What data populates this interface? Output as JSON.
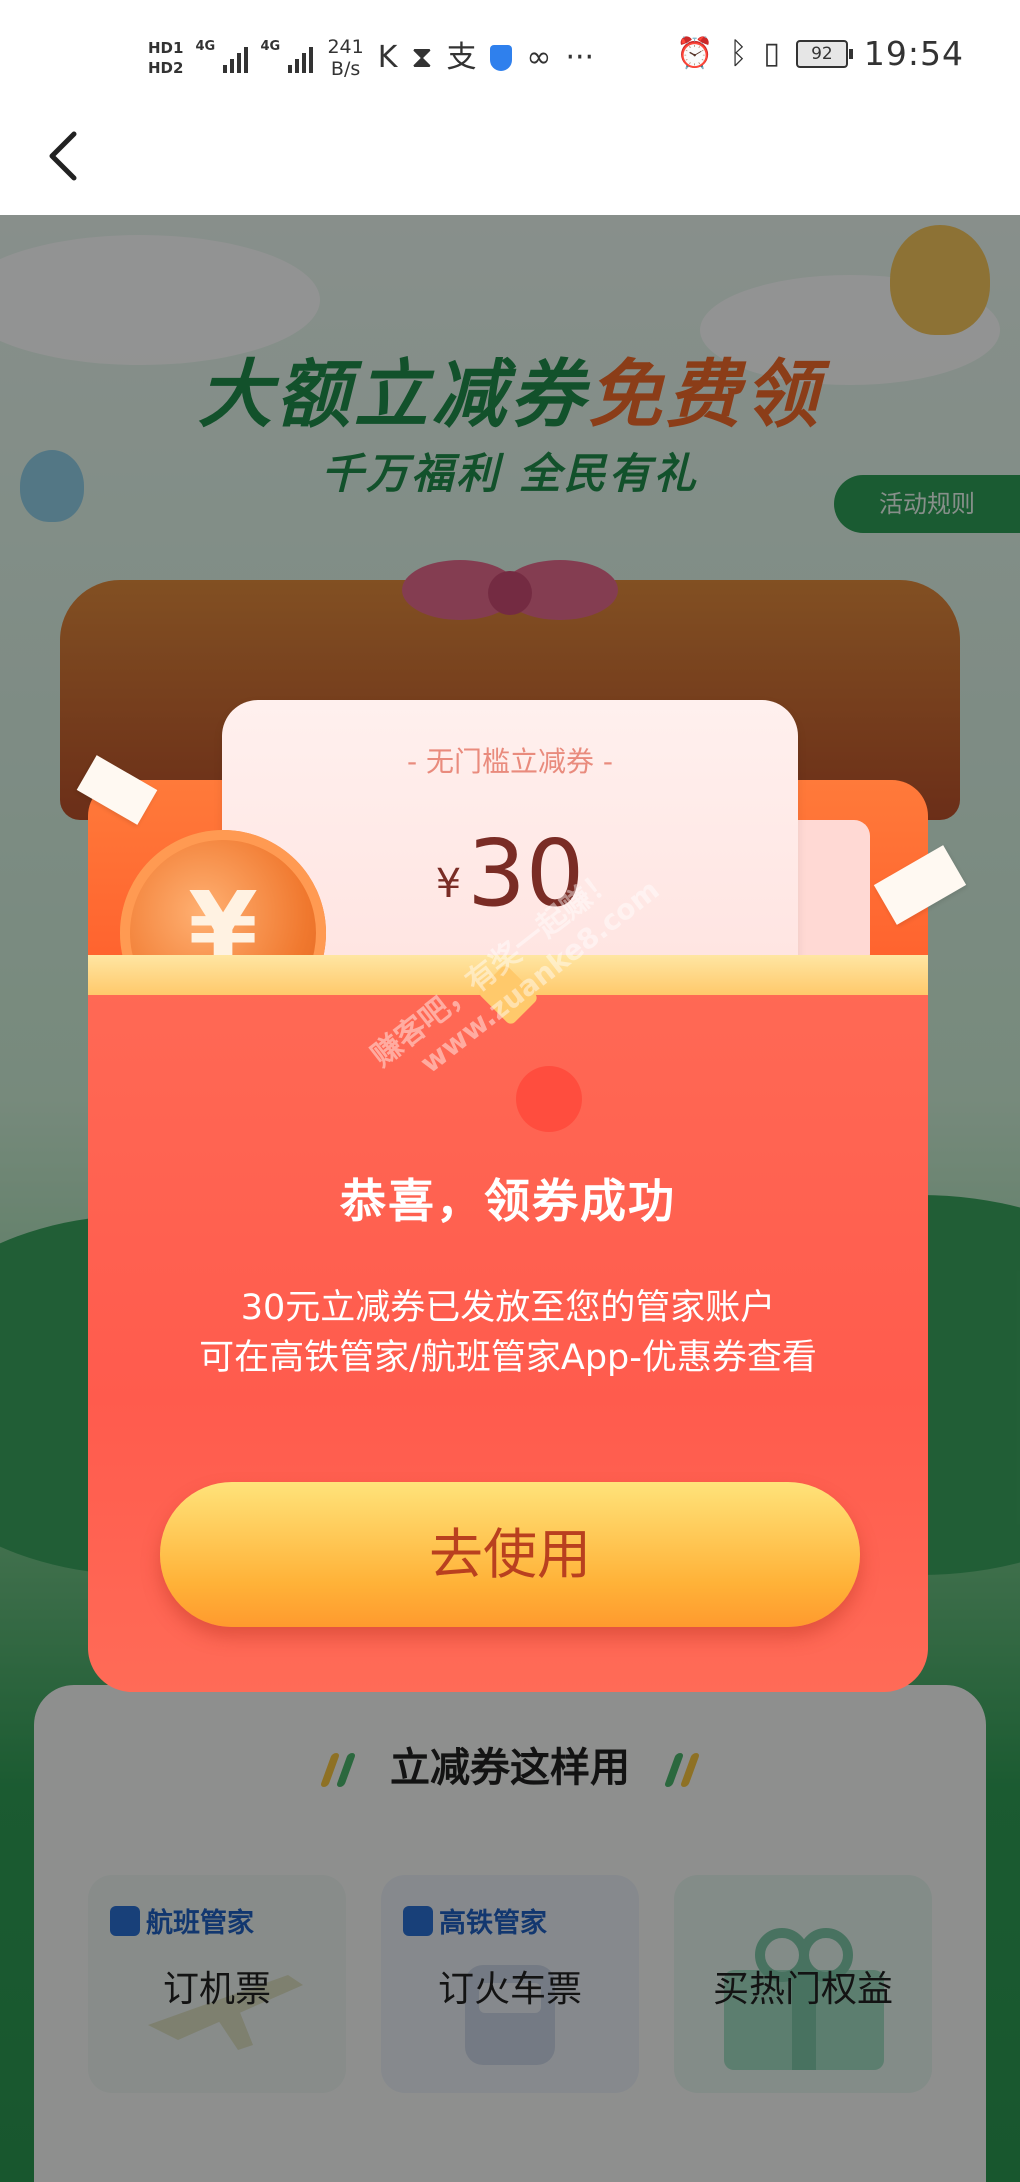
{
  "status_bar": {
    "hd1": "HD1",
    "hd2": "HD2",
    "net1": "4G",
    "net2": "4G",
    "speed_value": "241",
    "speed_unit": "B/s",
    "more": "···",
    "battery": "92",
    "time": "19:54"
  },
  "nav": {
    "back_icon": "chevron-left-icon"
  },
  "hero": {
    "title_part1": "大额立减券",
    "title_part2": "免费领",
    "subtitle": "千万福利  全民有礼",
    "rules_button": "活动规则"
  },
  "coupon": {
    "tag": "- 无门槛立减券 -",
    "currency": "¥",
    "amount": "30"
  },
  "watermark": {
    "line1": "赚客吧，有奖一起赚！",
    "line2": "www.zuanke8.com"
  },
  "result": {
    "title": "恭喜，领券成功",
    "desc_line1": "30元立减券已发放至您的管家账户",
    "desc_line2": "可在高铁管家/航班管家App-优惠券查看",
    "use_button": "去使用"
  },
  "guide": {
    "title": "立减券这样用",
    "cards": [
      {
        "brand": "航班管家",
        "label": "订机票"
      },
      {
        "brand": "高铁管家",
        "label": "订火车票"
      },
      {
        "brand": "",
        "label": "买热门权益"
      }
    ]
  },
  "colors": {
    "brand_green": "#1f8c4b",
    "accent_orange": "#f06a2a",
    "packet_red": "#ff5b4d",
    "button_yellow": "#ffc04d"
  }
}
